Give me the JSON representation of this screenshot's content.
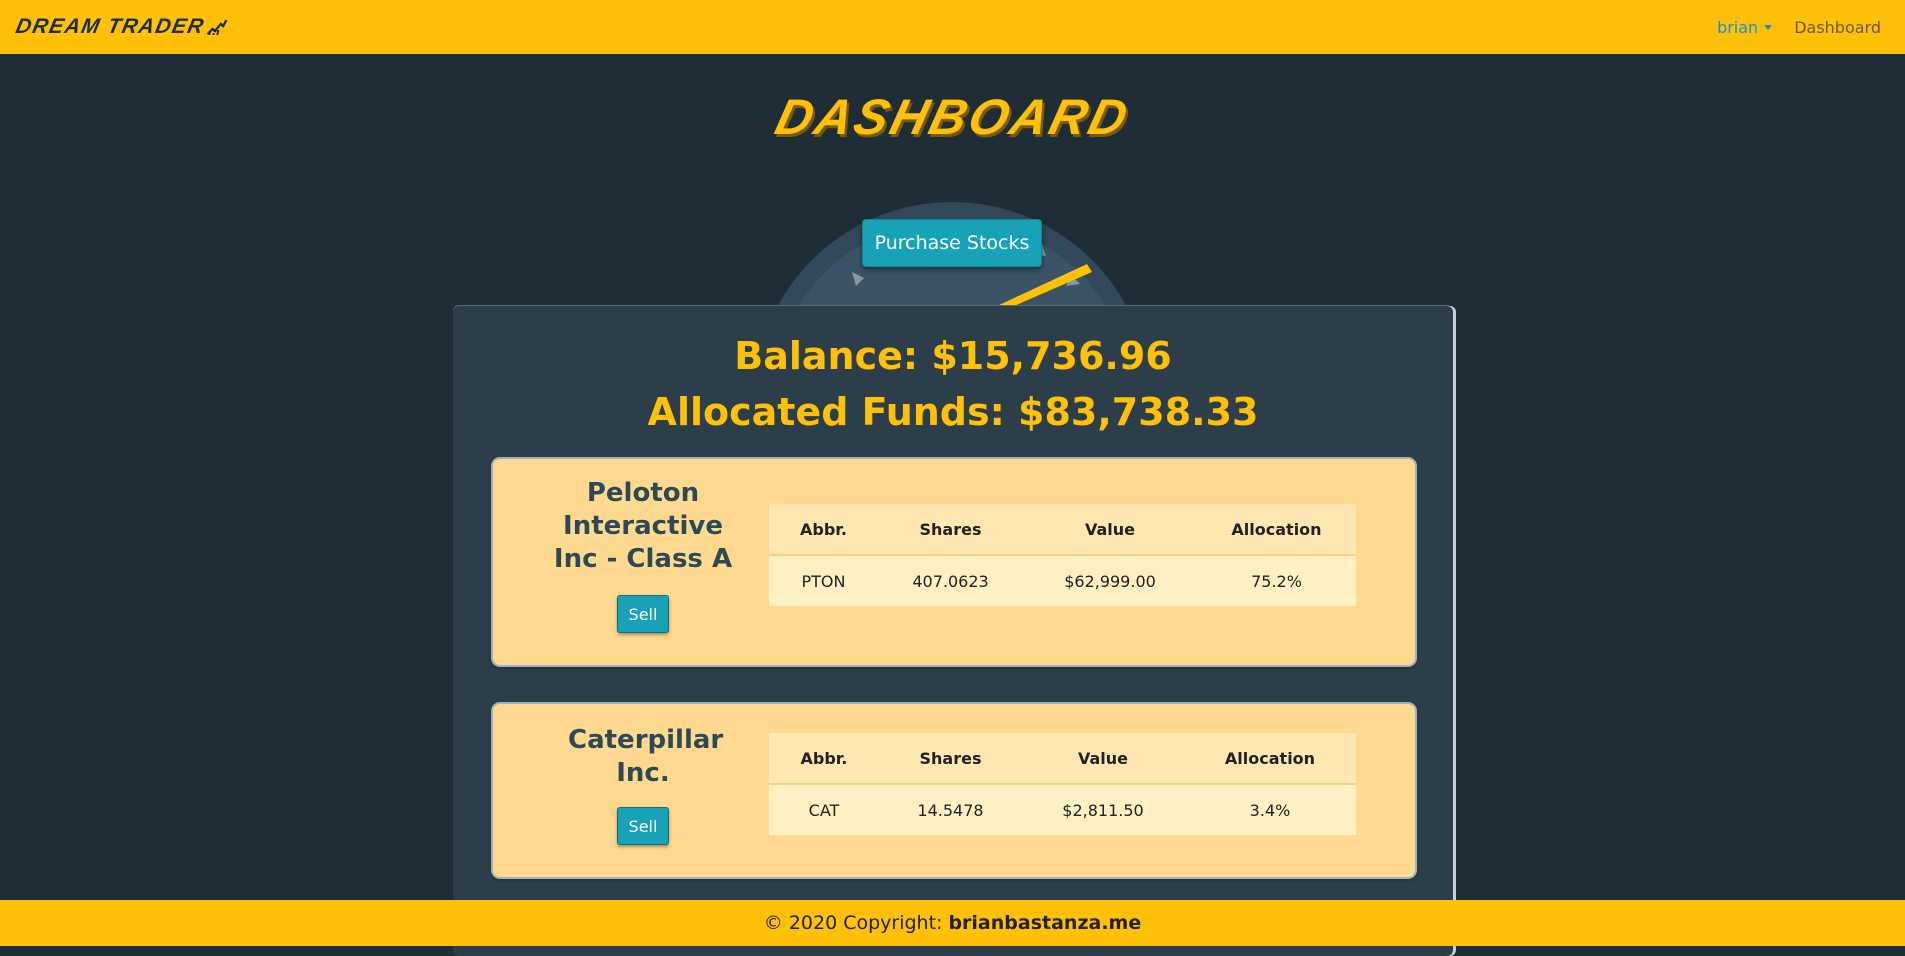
{
  "navbar": {
    "brand": "DREAM TRADER",
    "user": "brian",
    "dashboard_link": "Dashboard"
  },
  "page_title": "DASHBOARD",
  "purchase_button": "Purchase Stocks",
  "balance_line": "Balance: $15,736.96",
  "allocated_line": "Allocated Funds: $83,738.33",
  "table_headers": [
    "Abbr.",
    "Shares",
    "Value",
    "Allocation"
  ],
  "stocks": [
    {
      "name": "Peloton Interactive Inc - Class A",
      "sell_label": "Sell",
      "abbr": "PTON",
      "shares": "407.0623",
      "value": "$62,999.00",
      "allocation": "75.2%"
    },
    {
      "name": "Caterpillar Inc.",
      "sell_label": "Sell",
      "abbr": "CAT",
      "shares": "14.5478",
      "value": "$2,811.50",
      "allocation": "3.4%"
    }
  ],
  "footer": {
    "copyright": "© 2020 Copyright:",
    "site": "brianbastanza.me"
  },
  "colors": {
    "accent": "#ffc107",
    "background": "#1e2d36",
    "panel": "#2b3e4a",
    "card": "#ffd98f",
    "button": "#17a2b8"
  }
}
